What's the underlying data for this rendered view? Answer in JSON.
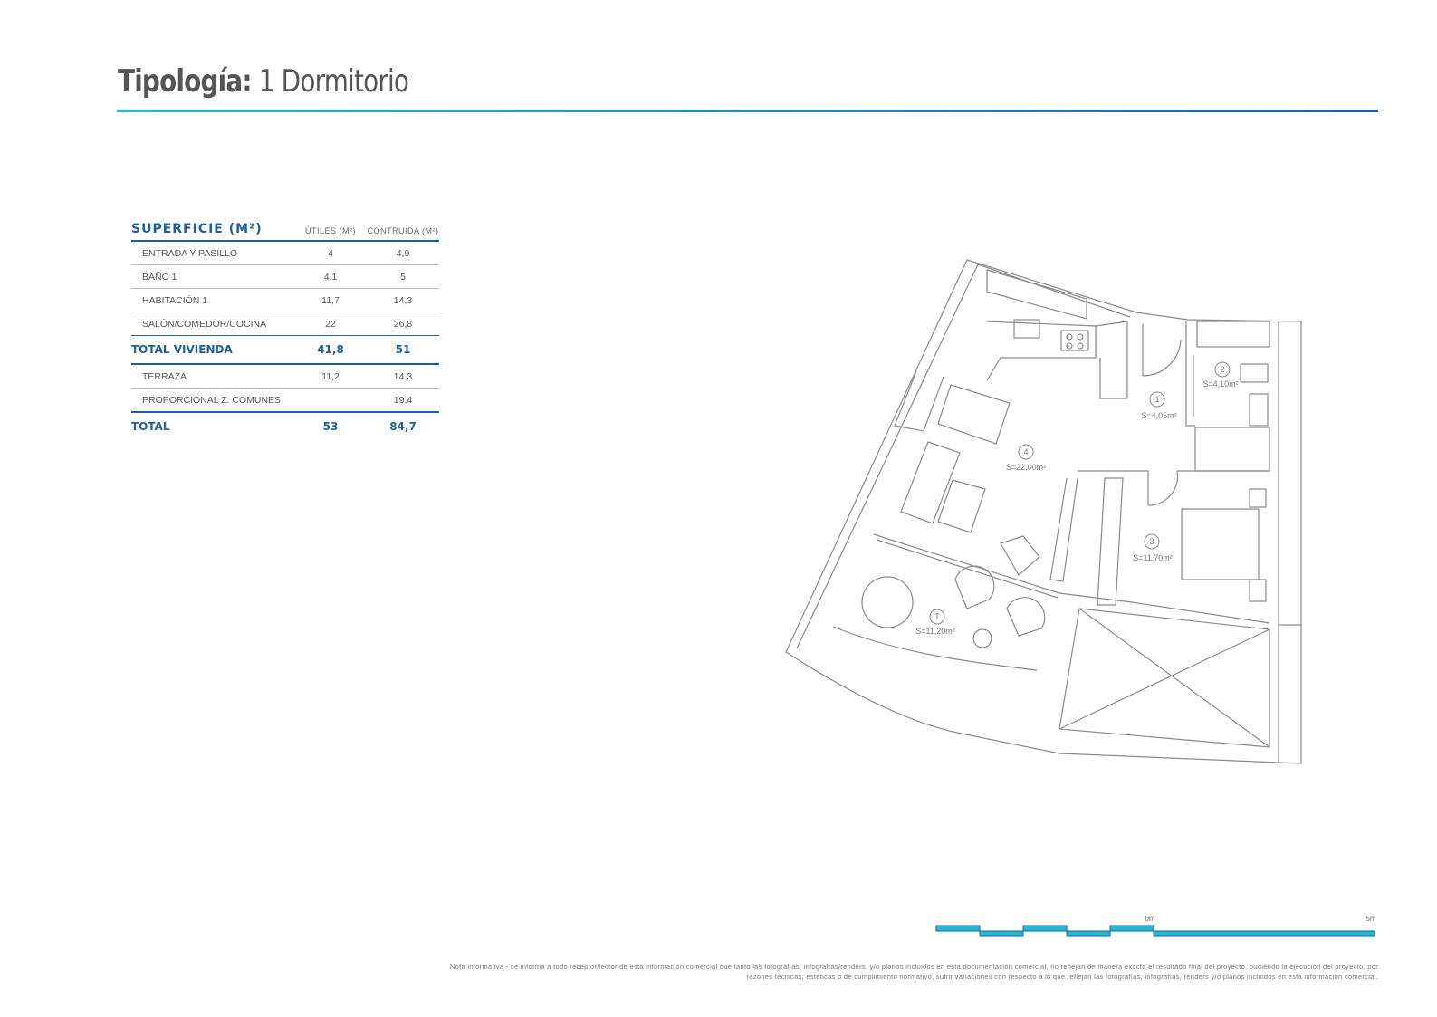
{
  "header": {
    "title_bold": "Tipología:",
    "title_rest": "1 Dormitorio"
  },
  "surface_table": {
    "heading": "SUPERFICIE (M²)",
    "col_utiles": "ÚTILES (M²)",
    "col_construida": "CONTRUIDA (M²)",
    "rows": [
      {
        "label": "ENTRADA Y PASILLO",
        "utiles": "4",
        "construida": "4,9"
      },
      {
        "label": "BAÑO 1",
        "utiles": "4,1",
        "construida": "5"
      },
      {
        "label": "HABITACIÓN 1",
        "utiles": "11,7",
        "construida": "14,3"
      },
      {
        "label": "SALÓN/COMEDOR/COCINA",
        "utiles": "22",
        "construida": "26,8"
      }
    ],
    "total_vivienda": {
      "label": "TOTAL VIVIENDA",
      "utiles": "41,8",
      "construida": "51"
    },
    "extra_rows": [
      {
        "label": "TERRAZA",
        "utiles": "11,2",
        "construida": "14,3"
      },
      {
        "label": "PROPORCIONAL Z. COMUNES",
        "utiles": "",
        "construida": "19,4"
      }
    ],
    "total": {
      "label": "TOTAL",
      "utiles": "53",
      "construida": "84,7"
    }
  },
  "floor_plan": {
    "rooms": [
      {
        "number": "1",
        "area": "S=4,05m²"
      },
      {
        "number": "2",
        "area": "S=4,10m²"
      },
      {
        "number": "3",
        "area": "S=11,70m²"
      },
      {
        "number": "4",
        "area": "S=22,00m²"
      },
      {
        "number": "T",
        "area": "S=11,20m²"
      }
    ]
  },
  "scale_bar": {
    "start_label": "0m",
    "end_label": "5m"
  },
  "note": "Nota informativa - se informa a todo receptor/lector de esta información comercial que tanto las fotografías, infografías/renders, y/o planos incluidos en esta documentación comercial, no reflejan de manera exacta el resultado final del proyecto, pudiendo la ejecución del proyecto, por razones técnicas, estéticas o de cumplimiento normativo, sufrir variaciones con respecto a lo que reflejan las fotografías, infografías, renders y/o planos incluidos en esta información comercial.",
  "colors": {
    "accent": "#1f5f9f",
    "accent_light": "#29b7cf",
    "plan_line": "#8a8a8a"
  }
}
